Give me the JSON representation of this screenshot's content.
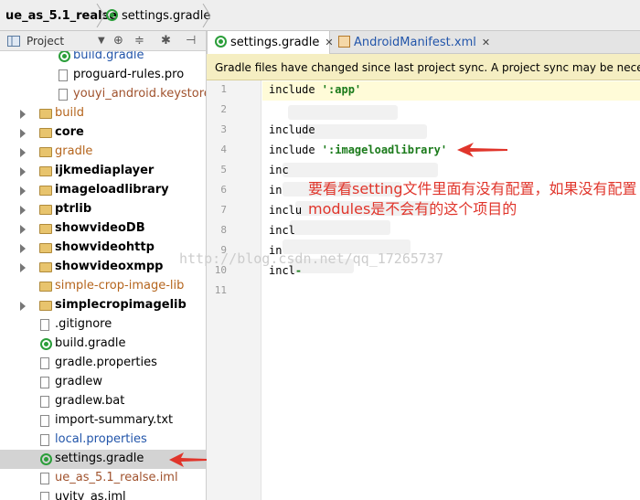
{
  "breadcrumb": {
    "project": "ue_as_5.1_realse",
    "file": "settings.gradle"
  },
  "project_panel": {
    "title": "Project",
    "icons": [
      "target-icon",
      "collapse-icon",
      "gear-icon",
      "pin-icon"
    ]
  },
  "tree": [
    {
      "label": "build.gradle",
      "type": "gradle",
      "style": "c-blue"
    },
    {
      "label": "proguard-rules.pro",
      "type": "file",
      "style": ""
    },
    {
      "label": "youyi_android.keystore",
      "type": "file",
      "style": "c-brown"
    },
    {
      "label": "build",
      "type": "folder",
      "style": "c-orange",
      "expandable": true
    },
    {
      "label": "core",
      "type": "folder",
      "style": "bold",
      "expandable": true
    },
    {
      "label": "gradle",
      "type": "folder",
      "style": "c-orange",
      "expandable": true
    },
    {
      "label": "ijkmediaplayer",
      "type": "folder",
      "style": "bold",
      "expandable": true
    },
    {
      "label": "imageloadlibrary",
      "type": "folder",
      "style": "bold",
      "expandable": true
    },
    {
      "label": "ptrlib",
      "type": "folder",
      "style": "bold",
      "expandable": true
    },
    {
      "label": "showvideoDB",
      "type": "folder",
      "style": "bold",
      "expandable": true
    },
    {
      "label": "showvideohttp",
      "type": "folder",
      "style": "bold",
      "expandable": true
    },
    {
      "label": "showvideoxmpp",
      "type": "folder",
      "style": "bold",
      "expandable": true
    },
    {
      "label": "simple-crop-image-lib",
      "type": "folder",
      "style": "c-orange",
      "expandable": false
    },
    {
      "label": "simplecropimagelib",
      "type": "folder",
      "style": "bold",
      "expandable": true
    },
    {
      "label": ".gitignore",
      "type": "file",
      "style": ""
    },
    {
      "label": "build.gradle",
      "type": "gradle",
      "style": ""
    },
    {
      "label": "gradle.properties",
      "type": "file",
      "style": ""
    },
    {
      "label": "gradlew",
      "type": "file",
      "style": ""
    },
    {
      "label": "gradlew.bat",
      "type": "file",
      "style": ""
    },
    {
      "label": "import-summary.txt",
      "type": "file",
      "style": ""
    },
    {
      "label": "local.properties",
      "type": "file",
      "style": "c-blue"
    },
    {
      "label": "settings.gradle",
      "type": "gradle",
      "style": "",
      "selected": true
    },
    {
      "label": "ue_as_5.1_realse.iml",
      "type": "file",
      "style": "c-brown"
    },
    {
      "label": "uvity_as.iml",
      "type": "file",
      "style": ""
    }
  ],
  "tabs": [
    {
      "label": "settings.gradle",
      "active": true
    },
    {
      "label": "AndroidManifest.xml",
      "active": false
    }
  ],
  "notification": "Gradle files have changed since last project sync. A project sync may be necessary",
  "line_numbers": [
    "1",
    "2",
    "3",
    "4",
    "5",
    "6",
    "7",
    "8",
    "9",
    "10",
    "11"
  ],
  "code": [
    {
      "kw": "include ",
      "str": "':app'"
    },
    {
      "kw": "",
      "str": ""
    },
    {
      "kw": "include",
      "str": ""
    },
    {
      "kw": "include ",
      "str": "':imageloadlibrary'"
    },
    {
      "kw": "inc",
      "str": ""
    },
    {
      "kw": "in",
      "str": ""
    },
    {
      "kw": "inclu",
      "str": ""
    },
    {
      "kw": "incl",
      "str": ""
    },
    {
      "kw": "in",
      "str": ""
    },
    {
      "kw": "incl",
      "str": "-"
    },
    {
      "kw": "",
      "str": ""
    }
  ],
  "annotation": {
    "note": "要看看setting文件里面有没有配置，如果没有配置modules是不会有的这个项目的",
    "watermark": "http://blog.csdn.net/qq_17265737",
    "color": "#e0352b"
  }
}
